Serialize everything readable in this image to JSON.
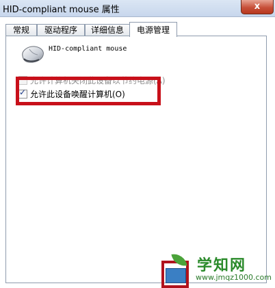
{
  "window": {
    "title": "HID-compliant mouse 属性",
    "close_label": "x"
  },
  "tabs": [
    {
      "label": "常规",
      "active": false
    },
    {
      "label": "驱动程序",
      "active": false
    },
    {
      "label": "详细信息",
      "active": false
    },
    {
      "label": "电源管理",
      "active": true
    }
  ],
  "device": {
    "name": "HID-compliant mouse",
    "icon": "mouse-icon"
  },
  "options": [
    {
      "label": "允许计算机关闭此设备以节约电源(A)",
      "checked": false,
      "enabled": false
    },
    {
      "label": "允许此设备唤醒计算机(O)",
      "checked": true,
      "enabled": true
    }
  ],
  "watermark": {
    "title": "学知网",
    "url": "www.jmqz1000.com"
  },
  "colors": {
    "highlight": "#c8101a",
    "titlebar": "#dbe6f4",
    "close": "#c7503a"
  }
}
